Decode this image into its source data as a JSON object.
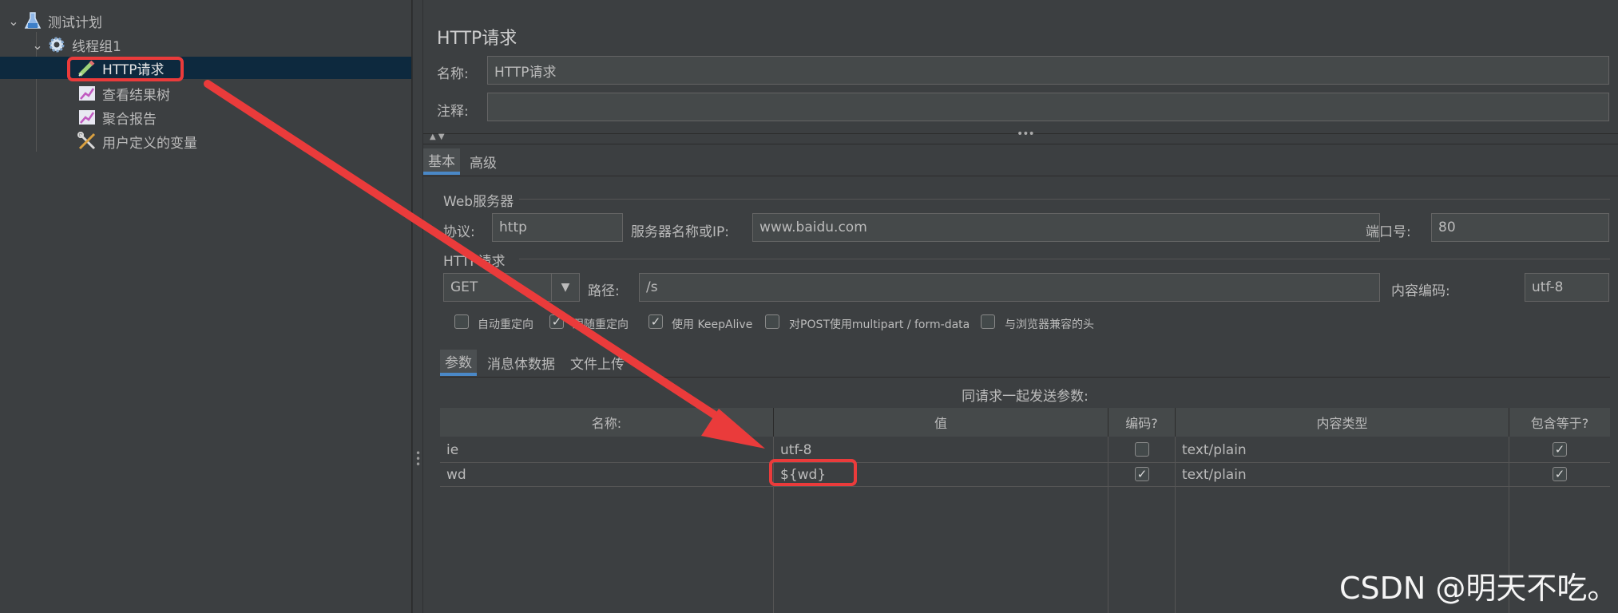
{
  "tree": {
    "items": [
      {
        "label": "测试计划",
        "icon": "flask-icon"
      },
      {
        "label": "线程组1",
        "icon": "gear-icon"
      },
      {
        "label": "HTTP请求",
        "icon": "pipette-icon"
      },
      {
        "label": "查看结果树",
        "icon": "graph-icon"
      },
      {
        "label": "聚合报告",
        "icon": "graph-icon"
      },
      {
        "label": "用户定义的变量",
        "icon": "tools-icon"
      }
    ]
  },
  "panel": {
    "title": "HTTP请求",
    "name_label": "名称:",
    "name_value": "HTTP请求",
    "comment_label": "注释:",
    "comment_value": ""
  },
  "tabs": {
    "basic": "基本",
    "advanced": "高级"
  },
  "web_server": {
    "section": "Web服务器",
    "protocol_label": "协议:",
    "protocol_value": "http",
    "server_label": "服务器名称或IP:",
    "server_value": "www.baidu.com",
    "port_label": "端口号:",
    "port_value": "80"
  },
  "http_request": {
    "section": "HTTP请求",
    "method": "GET",
    "path_label": "路径:",
    "path_value": "/s",
    "encoding_label": "内容编码:",
    "encoding_value": "utf-8"
  },
  "options": [
    {
      "label": "自动重定向",
      "checked": false
    },
    {
      "label": "跟随重定向",
      "checked": true
    },
    {
      "label": "使用 KeepAlive",
      "checked": true
    },
    {
      "label": "对POST使用multipart / form-data",
      "checked": false
    },
    {
      "label": "与浏览器兼容的头",
      "checked": false
    }
  ],
  "subtabs": {
    "params": "参数",
    "body": "消息体数据",
    "files": "文件上传"
  },
  "params_table": {
    "caption": "同请求一起发送参数:",
    "headers": [
      "名称:",
      "值",
      "编码?",
      "内容类型",
      "包含等于?"
    ],
    "rows": [
      {
        "name": "ie",
        "value": "utf-8",
        "encode": false,
        "content_type": "text/plain",
        "include_equals": true
      },
      {
        "name": "wd",
        "value": "${wd}",
        "encode": true,
        "content_type": "text/plain",
        "include_equals": true
      }
    ]
  },
  "watermark": "CSDN @明天不吃。",
  "colors": {
    "highlight": "#ea3b3b",
    "selection": "#0d293e",
    "tab_accent": "#4a88c7"
  }
}
